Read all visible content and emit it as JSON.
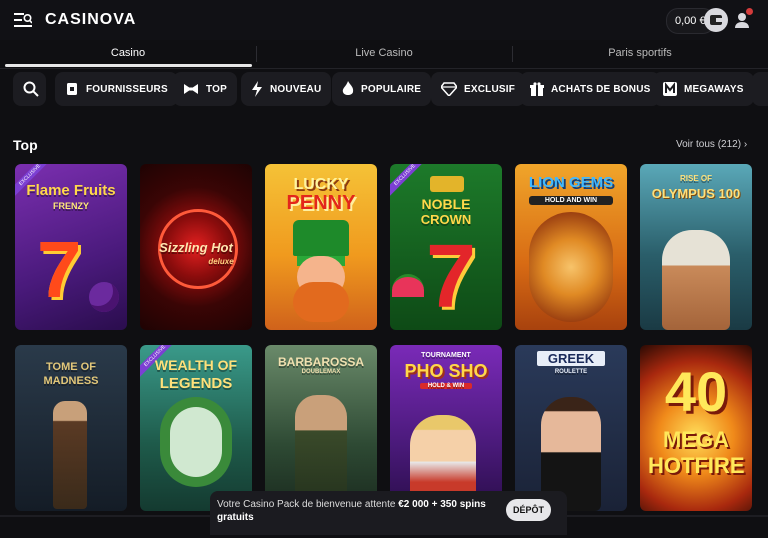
{
  "header": {
    "logo": "CASINOVA",
    "balance": "0,00 €",
    "icons": [
      "menu-icon",
      "wallet-icon",
      "user-icon",
      "notification-badge"
    ]
  },
  "nav": {
    "tabs": [
      {
        "label": "Casino",
        "active": true
      },
      {
        "label": "Live Casino",
        "active": false
      },
      {
        "label": "Paris sportifs",
        "active": false
      }
    ]
  },
  "filters": [
    {
      "label": "FOURNISSEURS",
      "icon": "card-icon"
    },
    {
      "label": "TOP",
      "icon": "bowtie-icon"
    },
    {
      "label": "NOUVEAU",
      "icon": "bolt-icon"
    },
    {
      "label": "POPULAIRE",
      "icon": "flame-icon"
    },
    {
      "label": "EXCLUSIF",
      "icon": "diamond-icon"
    },
    {
      "label": "ACHATS DE BONUS",
      "icon": "gift-icon"
    },
    {
      "label": "MEGAWAYS",
      "icon": "m-icon"
    }
  ],
  "section": {
    "title": "Top",
    "see_all": "Voir tous (212)"
  },
  "games": [
    {
      "title": "Flame Fruits",
      "subtitle": "FRENZY",
      "badge": "EXCLUSIVE"
    },
    {
      "title": "Sizzling Hot",
      "subtitle": "deluxe",
      "badge": ""
    },
    {
      "title": "LUCKY",
      "subtitle": "PENNY",
      "badge": ""
    },
    {
      "title": "NOBLE",
      "subtitle": "CROWN",
      "badge": "EXCLUSIVE"
    },
    {
      "title": "LION GEMS",
      "subtitle": "HOLD AND WIN",
      "badge": ""
    },
    {
      "title": "RISE OF",
      "subtitle": "OLYMPUS 100",
      "badge": ""
    },
    {
      "title": "TOME OF",
      "subtitle": "MADNESS",
      "badge": ""
    },
    {
      "title": "WEALTH OF",
      "subtitle": "LEGENDS",
      "badge": "EXCLUSIVE"
    },
    {
      "title": "BARBAROSSA",
      "subtitle": "DOUBLEMAX",
      "badge": ""
    },
    {
      "title": "PHO SHO",
      "subtitle": "HOLD & WIN",
      "badge": "TOURNAMENT"
    },
    {
      "title": "GREEK",
      "subtitle": "ROULETTE",
      "badge": ""
    },
    {
      "title": "40",
      "subtitle": "MEGA HOTFIRE",
      "badge": ""
    }
  ],
  "promo": {
    "text_prefix": "Votre Casino Pack de bienvenue attente ",
    "amount": "€2 000 + 350 spins",
    "text_suffix": "gratuits",
    "button": "DÉPÔT"
  }
}
